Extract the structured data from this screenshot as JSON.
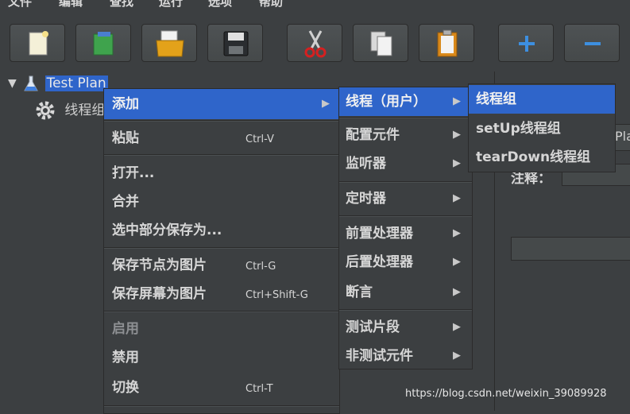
{
  "menubar": {
    "items": [
      "文件",
      "编辑",
      "查找",
      "运行",
      "选项",
      "帮助"
    ]
  },
  "toolbar": {
    "buttons": [
      "new-icon",
      "templates-icon",
      "open-icon",
      "save-icon",
      "cut-icon",
      "copy-icon",
      "paste-icon",
      "expand-icon",
      "collapse-icon"
    ]
  },
  "tree": {
    "test_plan": "Test Plan",
    "thread_group": "线程组"
  },
  "right_panel": {
    "partial_name": "Pla",
    "comment_label": "注释："
  },
  "context_menu": {
    "add": "添加",
    "paste": "粘贴",
    "paste_accel": "Ctrl-V",
    "open": "打开...",
    "merge": "合并",
    "save_selection": "选中部分保存为...",
    "save_node_image": "保存节点为图片",
    "save_node_image_accel": "Ctrl-G",
    "save_screen_image": "保存屏幕为图片",
    "save_screen_image_accel": "Ctrl+Shift-G",
    "enable": "启用",
    "disable": "禁用",
    "toggle": "切换",
    "toggle_accel": "Ctrl-T"
  },
  "add_submenu": {
    "threads": "线程（用户）",
    "config": "配置元件",
    "listener": "监听器",
    "timer": "定时器",
    "pre_processor": "前置处理器",
    "post_processor": "后置处理器",
    "assertion": "断言",
    "test_fragment": "测试片段",
    "non_test": "非测试元件"
  },
  "threads_submenu": {
    "thread_group": "线程组",
    "setup_thread_group": "setUp线程组",
    "teardown_thread_group": "tearDown线程组"
  },
  "watermark": "https://blog.csdn.net/weixin_39089928",
  "colors": {
    "background": "#3c3f41",
    "selection": "#2f65ca",
    "text": "#d6d6d6"
  }
}
